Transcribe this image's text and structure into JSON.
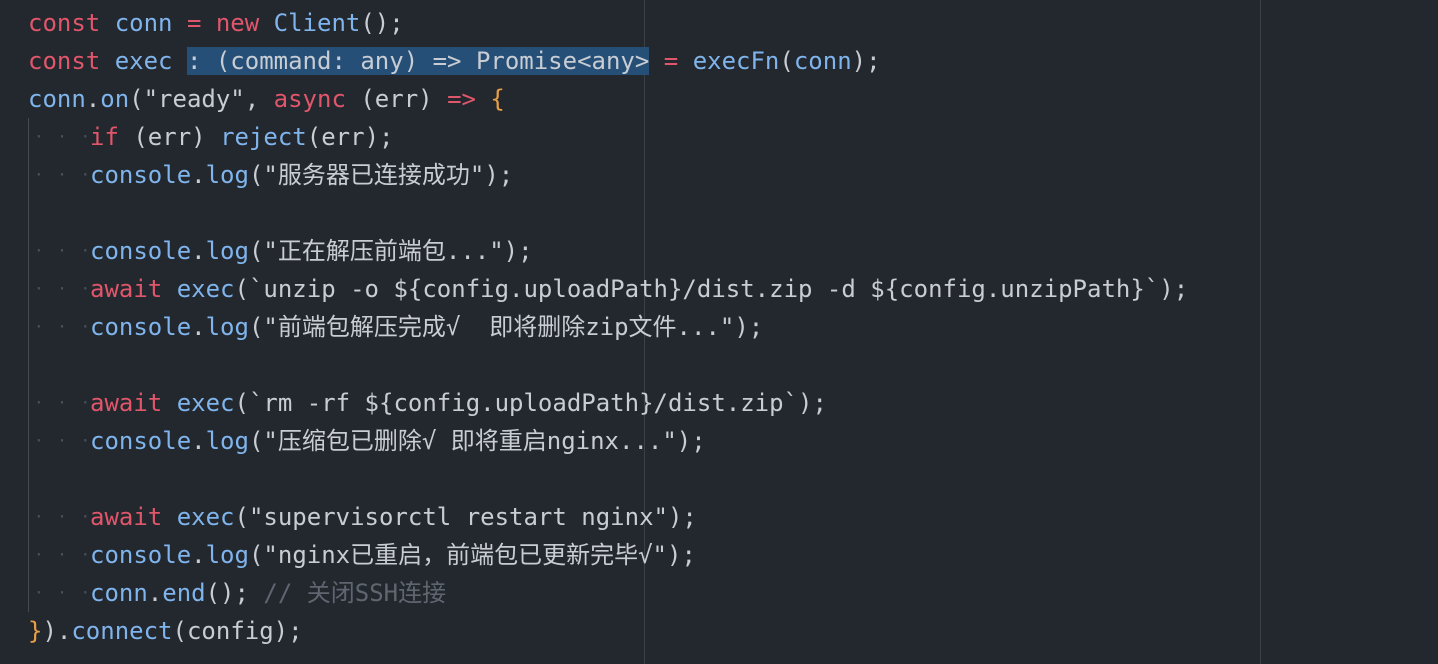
{
  "editor": {
    "lines": [
      {
        "indent": false,
        "tokens": [
          {
            "t": "const ",
            "c": "kw"
          },
          {
            "t": "conn ",
            "c": "fn"
          },
          {
            "t": "= ",
            "c": "kw"
          },
          {
            "t": "new ",
            "c": "kw"
          },
          {
            "t": "Client",
            "c": "fn"
          },
          {
            "t": "();",
            "c": "pr"
          }
        ]
      },
      {
        "indent": false,
        "tokens": [
          {
            "t": "const ",
            "c": "kw"
          },
          {
            "t": "exec ",
            "c": "fn"
          },
          {
            "t": ": (command: any) => Promise<any>",
            "c": "sel"
          },
          {
            "t": " = ",
            "c": "kw"
          },
          {
            "t": "execFn",
            "c": "fn"
          },
          {
            "t": "(",
            "c": "pr"
          },
          {
            "t": "conn",
            "c": "fn"
          },
          {
            "t": ");",
            "c": "pr"
          }
        ]
      },
      {
        "indent": false,
        "tokens": [
          {
            "t": "conn",
            "c": "fn"
          },
          {
            "t": ".",
            "c": "pr"
          },
          {
            "t": "on",
            "c": "fn"
          },
          {
            "t": "(\"ready\", ",
            "c": "pr"
          },
          {
            "t": "async ",
            "c": "kw"
          },
          {
            "t": "(err) ",
            "c": "pr"
          },
          {
            "t": "=> ",
            "c": "kw"
          },
          {
            "t": "{",
            "c": "brk"
          }
        ]
      },
      {
        "indent": true,
        "tokens": [
          {
            "t": "if ",
            "c": "kw"
          },
          {
            "t": "(err) ",
            "c": "pr"
          },
          {
            "t": "reject",
            "c": "fn"
          },
          {
            "t": "(err);",
            "c": "pr"
          }
        ]
      },
      {
        "indent": true,
        "tokens": [
          {
            "t": "console",
            "c": "fn"
          },
          {
            "t": ".",
            "c": "pr"
          },
          {
            "t": "log",
            "c": "fn"
          },
          {
            "t": "(\"服务器已连接成功\");",
            "c": "pr"
          }
        ]
      },
      {
        "indent": true,
        "empty": true,
        "tokens": []
      },
      {
        "indent": true,
        "tokens": [
          {
            "t": "console",
            "c": "fn"
          },
          {
            "t": ".",
            "c": "pr"
          },
          {
            "t": "log",
            "c": "fn"
          },
          {
            "t": "(\"正在解压前端包...\");",
            "c": "pr"
          }
        ]
      },
      {
        "indent": true,
        "tokens": [
          {
            "t": "await ",
            "c": "kw"
          },
          {
            "t": "exec",
            "c": "fn"
          },
          {
            "t": "(`unzip -o ${config.uploadPath}/dist.zip -d ${config.unzipPath}`);",
            "c": "pr"
          }
        ]
      },
      {
        "indent": true,
        "tokens": [
          {
            "t": "console",
            "c": "fn"
          },
          {
            "t": ".",
            "c": "pr"
          },
          {
            "t": "log",
            "c": "fn"
          },
          {
            "t": "(\"前端包解压完成√  即将删除zip文件...\");",
            "c": "pr"
          }
        ]
      },
      {
        "indent": true,
        "empty": true,
        "tokens": []
      },
      {
        "indent": true,
        "tokens": [
          {
            "t": "await ",
            "c": "kw"
          },
          {
            "t": "exec",
            "c": "fn"
          },
          {
            "t": "(`rm -rf ${config.uploadPath}/dist.zip`);",
            "c": "pr"
          }
        ]
      },
      {
        "indent": true,
        "tokens": [
          {
            "t": "console",
            "c": "fn"
          },
          {
            "t": ".",
            "c": "pr"
          },
          {
            "t": "log",
            "c": "fn"
          },
          {
            "t": "(\"压缩包已删除√ 即将重启nginx...\");",
            "c": "pr"
          }
        ]
      },
      {
        "indent": true,
        "empty": true,
        "tokens": []
      },
      {
        "indent": true,
        "tokens": [
          {
            "t": "await ",
            "c": "kw"
          },
          {
            "t": "exec",
            "c": "fn"
          },
          {
            "t": "(\"supervisorctl restart nginx\");",
            "c": "pr"
          }
        ]
      },
      {
        "indent": true,
        "tokens": [
          {
            "t": "console",
            "c": "fn"
          },
          {
            "t": ".",
            "c": "pr"
          },
          {
            "t": "log",
            "c": "fn"
          },
          {
            "t": "(\"nginx已重启，前端包已更新完毕√\");",
            "c": "pr"
          }
        ]
      },
      {
        "indent": true,
        "tokens": [
          {
            "t": "conn",
            "c": "fn"
          },
          {
            "t": ".",
            "c": "pr"
          },
          {
            "t": "end",
            "c": "fn"
          },
          {
            "t": "(); ",
            "c": "pr"
          },
          {
            "t": "// 关闭SSH连接",
            "c": "cmt"
          }
        ]
      },
      {
        "indent": false,
        "tokens": [
          {
            "t": "}",
            "c": "brk"
          },
          {
            "t": ").",
            "c": "pr"
          },
          {
            "t": "connect",
            "c": "fn"
          },
          {
            "t": "(config);",
            "c": "pr"
          }
        ]
      }
    ]
  }
}
